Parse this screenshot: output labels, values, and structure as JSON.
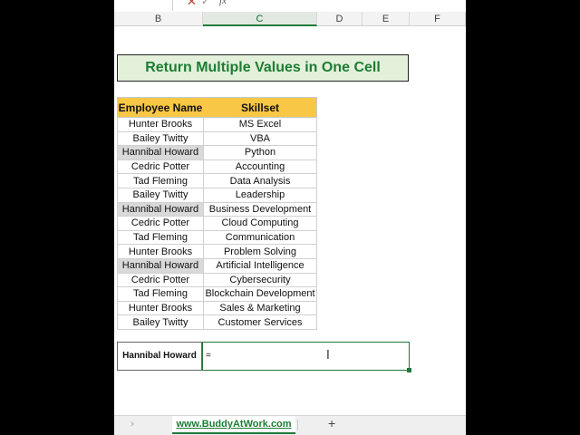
{
  "formula_bar": {
    "fx": "fx"
  },
  "columns": [
    "B",
    "C",
    "D",
    "E",
    "F"
  ],
  "title": "Return Multiple Values in One Cell",
  "table": {
    "headers": [
      "Employee Name",
      "Skillset"
    ],
    "rows": [
      {
        "name": "Hunter Brooks",
        "skill": "MS Excel",
        "highlight": false
      },
      {
        "name": "Bailey Twitty",
        "skill": "VBA",
        "highlight": false
      },
      {
        "name": "Hannibal Howard",
        "skill": "Python",
        "highlight": true
      },
      {
        "name": "Cedric Potter",
        "skill": "Accounting",
        "highlight": false
      },
      {
        "name": "Tad Fleming",
        "skill": "Data Analysis",
        "highlight": false
      },
      {
        "name": "Bailey Twitty",
        "skill": "Leadership",
        "highlight": false
      },
      {
        "name": "Hannibal Howard",
        "skill": "Business Development",
        "highlight": true
      },
      {
        "name": "Cedric Potter",
        "skill": "Cloud Computing",
        "highlight": false
      },
      {
        "name": "Tad Fleming",
        "skill": "Communication",
        "highlight": false
      },
      {
        "name": "Hunter Brooks",
        "skill": "Problem Solving",
        "highlight": false
      },
      {
        "name": "Hannibal Howard",
        "skill": "Artificial Intelligence",
        "highlight": true
      },
      {
        "name": "Cedric Potter",
        "skill": "Cybersecurity",
        "highlight": false
      },
      {
        "name": "Tad Fleming",
        "skill": "Blockchain Development",
        "highlight": false
      },
      {
        "name": "Hunter Brooks",
        "skill": "Sales & Marketing",
        "highlight": false
      },
      {
        "name": "Bailey Twitty",
        "skill": "Customer Services",
        "highlight": false
      }
    ]
  },
  "lookup": {
    "label": "Hannibal Howard",
    "input_value": "="
  },
  "tabs": {
    "active": "www.BuddyAtWork.com",
    "prev_icon": "chevron-right-icon",
    "add_icon": "plus-icon"
  },
  "colors": {
    "title_text": "#1d7d33",
    "title_bg": "#e3f0da",
    "header_bg": "#f8c745",
    "highlight_bg": "#d9d9d9",
    "active_green": "#1f7a3c"
  }
}
